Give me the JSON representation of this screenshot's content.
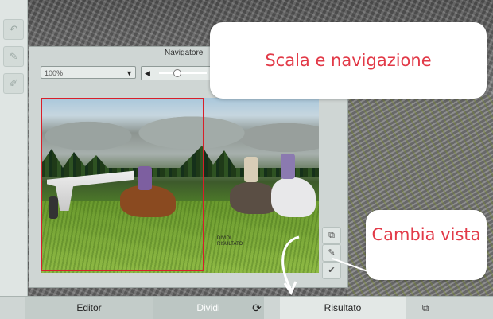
{
  "navigator": {
    "title": "Navigatore",
    "zoom_value": "100%",
    "slider_left_symbol": "◀",
    "select_arrow": "▼",
    "watermark": "DIVIDI\nRISULTATO"
  },
  "callouts": {
    "top": "Scala e navigazione",
    "right": "Cambia vista"
  },
  "tabs": {
    "editor": "Editor",
    "dividi": "Dividi",
    "risultato": "Risultato",
    "rotate_icon": "⟳",
    "compare_icon": "⧉"
  },
  "toolbar_icons": {
    "tool1": "↶",
    "tool2": "✎",
    "tool3": "✐"
  },
  "mini_buttons": {
    "compare": "⧉",
    "brush": "✎",
    "check": "✔"
  }
}
